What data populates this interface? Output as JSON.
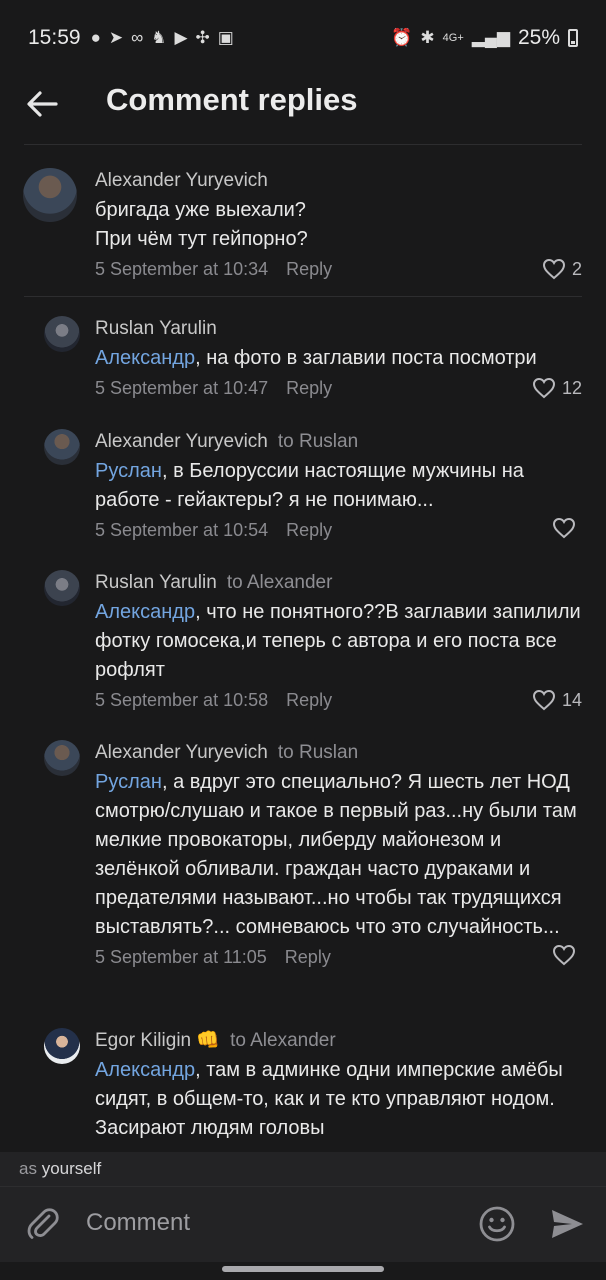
{
  "status_bar": {
    "time": "15:59",
    "left_icons": [
      "spotify-icon",
      "telegram-icon",
      "voicemail-icon",
      "horse-icon",
      "youtube-icon",
      "fan-icon",
      "image-icon"
    ],
    "network": "4G+",
    "battery": "25%"
  },
  "header": {
    "title": "Comment replies"
  },
  "comments": [
    {
      "author": "Alexander Yuryevich",
      "to": "",
      "mention": "",
      "text": "бригада уже выехали?\nПри чём тут гейпорно?",
      "date": "5 September at 10:34",
      "reply_label": "Reply",
      "likes": "2"
    },
    {
      "author": "Ruslan Yarulin",
      "to": "",
      "mention": "Александр",
      "text": ", на фото в заглавии поста посмотри",
      "date": "5 September at 10:47",
      "reply_label": "Reply",
      "likes": "12"
    },
    {
      "author": "Alexander Yuryevich",
      "to": "to Ruslan",
      "mention": "Руслан",
      "text": ", в Белоруссии настоящие мужчины на работе - гейактеры? я не понимаю...",
      "date": "5 September at 10:54",
      "reply_label": "Reply",
      "likes": ""
    },
    {
      "author": "Ruslan Yarulin",
      "to": "to Alexander",
      "mention": "Александр",
      "text": ", что не понятного??В заглавии запилили фотку гомосека,и теперь с автора и его поста все рофлят",
      "date": "5 September at 10:58",
      "reply_label": "Reply",
      "likes": "14"
    },
    {
      "author": "Alexander Yuryevich",
      "to": "to Ruslan",
      "mention": "Руслан",
      "text": ", а вдруг это специально? Я шесть лет НОД смотрю/слушаю и такое в первый раз...ну были там мелкие провокаторы, либерду майонезом и зелёнкой обливали. граждан часто дураками и предателями называют...но чтобы так трудящихся выставлять?... сомневаюсь что это случайность...",
      "date": "5 September at 11:05",
      "reply_label": "Reply",
      "likes": ""
    },
    {
      "author": "Egor Kiligin",
      "author_emoji": "👊",
      "to": "to Alexander",
      "mention": "Александр",
      "text": ", там в админке одни имперские амёбы сидят, в общем-то, как и те кто управляют нодом. Засирают людям головы",
      "date": "",
      "reply_label": "",
      "likes": ""
    }
  ],
  "composer": {
    "as_prefix": "as",
    "as_who": "yourself",
    "placeholder": "Comment"
  },
  "colors": {
    "background": "#19191a",
    "mention": "#73a5e0",
    "muted": "#8a8a8f"
  }
}
